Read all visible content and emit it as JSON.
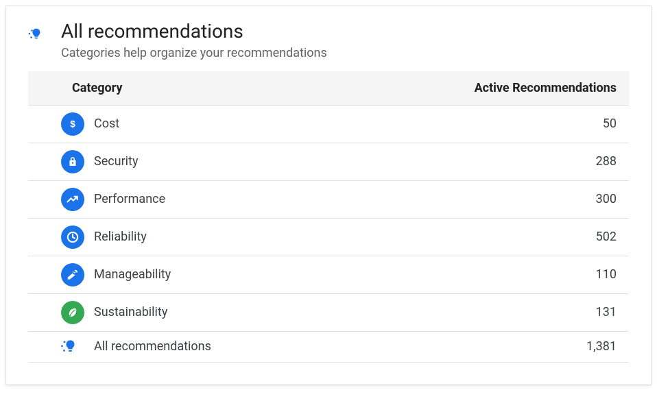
{
  "header": {
    "title": "All recommendations",
    "subtitle": "Categories help organize your recommendations"
  },
  "table": {
    "headers": {
      "category": "Category",
      "count": "Active Recommendations"
    },
    "rows": [
      {
        "icon": "dollar",
        "color": "blue",
        "label": "Cost",
        "count": "50"
      },
      {
        "icon": "lock",
        "color": "blue",
        "label": "Security",
        "count": "288"
      },
      {
        "icon": "trend",
        "color": "blue",
        "label": "Performance",
        "count": "300"
      },
      {
        "icon": "clock",
        "color": "blue",
        "label": "Reliability",
        "count": "502"
      },
      {
        "icon": "wrench",
        "color": "blue",
        "label": "Manageability",
        "count": "110"
      },
      {
        "icon": "leaf",
        "color": "green",
        "label": "Sustainability",
        "count": "131"
      },
      {
        "icon": "spark",
        "color": "none",
        "label": "All recommendations",
        "count": "1,381"
      }
    ]
  }
}
